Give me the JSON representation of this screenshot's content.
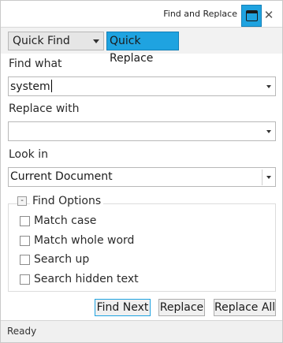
{
  "window": {
    "title": "Find and Replace",
    "pin_icon": "window-icon",
    "close_glyph": "✕"
  },
  "modes": {
    "selected_mode": "Quick Find",
    "active_tab": "Quick Replace"
  },
  "find": {
    "label": "Find what",
    "value": "system"
  },
  "replace": {
    "label": "Replace with",
    "value": ""
  },
  "look_in": {
    "label": "Look in",
    "value": "Current Document"
  },
  "find_options": {
    "toggle_glyph": "-",
    "title": "Find Options",
    "items": [
      {
        "label": "Match case",
        "checked": false
      },
      {
        "label": "Match whole word",
        "checked": false
      },
      {
        "label": "Search up",
        "checked": false
      },
      {
        "label": "Search hidden text",
        "checked": false
      }
    ]
  },
  "buttons": {
    "find_next": "Find Next",
    "replace": "Replace",
    "replace_all": "Replace All"
  },
  "status": {
    "text": "Ready"
  },
  "colors": {
    "accent": "#1fa3e0"
  }
}
